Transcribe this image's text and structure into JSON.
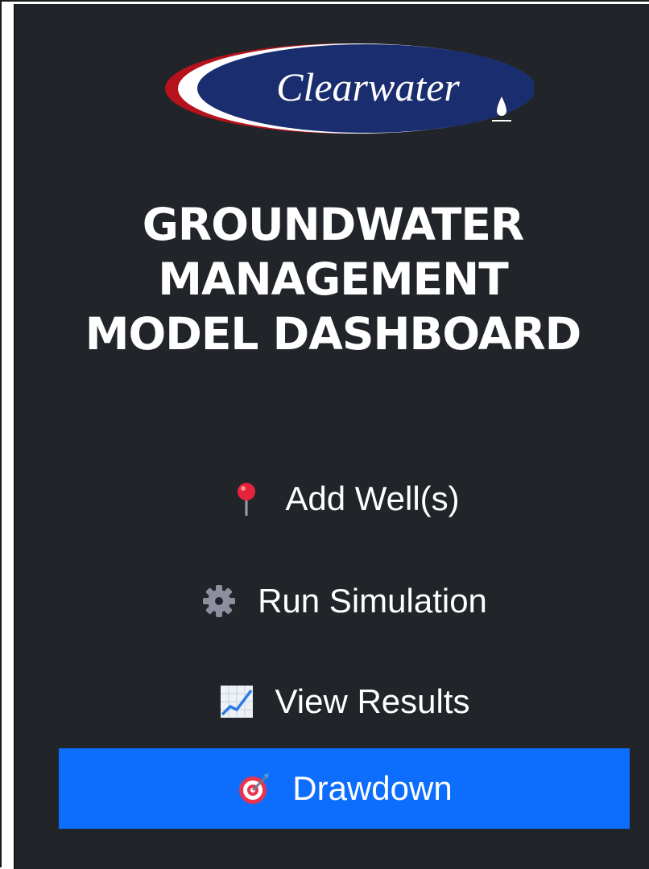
{
  "logo": {
    "text": "Clearwater"
  },
  "sidebar": {
    "title_lines": [
      "GROUNDWATER",
      "MANAGEMENT",
      "MODEL DASHBOARD"
    ],
    "items": [
      {
        "label": "Add Well(s)",
        "icon": "pushpin-icon",
        "active": false
      },
      {
        "label": "Run Simulation",
        "icon": "gear-icon",
        "active": false
      },
      {
        "label": "View Results",
        "icon": "chart-increasing-icon",
        "active": false
      },
      {
        "label": "Drawdown",
        "icon": "target-icon",
        "active": true
      }
    ]
  },
  "colors": {
    "sidebar_bg": "#212529",
    "active_bg": "#0d6efd",
    "logo_navy": "#1a2d6e",
    "logo_red": "#b5121b"
  }
}
